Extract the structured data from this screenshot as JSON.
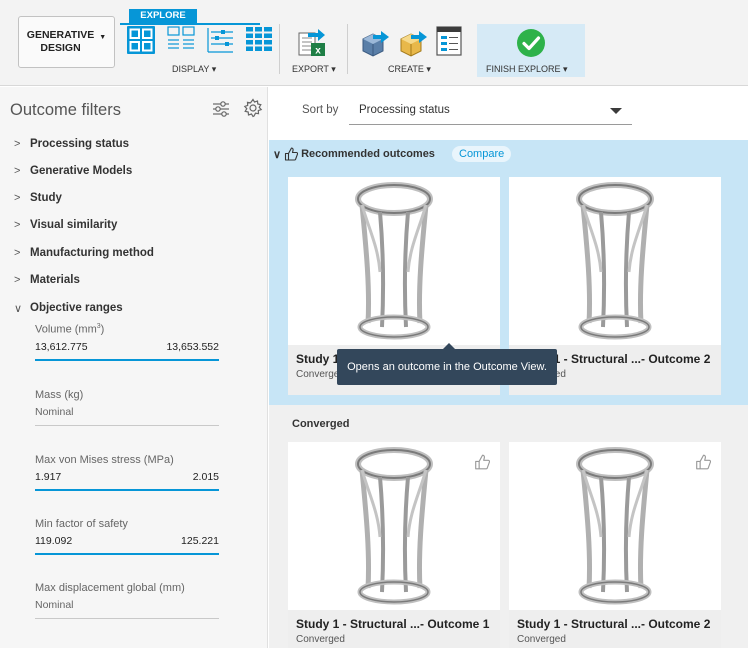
{
  "toolbar": {
    "generative_design": "GENERATIVE\nDESIGN",
    "explore_tab": "EXPLORE",
    "display": "DISPLAY",
    "export": "EXPORT",
    "create": "CREATE",
    "finish_explore": "FINISH EXPLORE",
    "dropdown_caret": "▾"
  },
  "left_panel": {
    "title": "Outcome filters",
    "filters": [
      "Processing status",
      "Generative Models",
      "Study",
      "Visual similarity",
      "Manufacturing method",
      "Materials",
      "Objective ranges"
    ],
    "ranges": {
      "volume": {
        "label": "Volume (mm",
        "unit_sup": "3",
        "label_end": ")",
        "min": "13,612.775",
        "max": "13,653.552"
      },
      "mass": {
        "label": "Mass (kg)",
        "value": "Nominal"
      },
      "stress": {
        "label": "Max von Mises stress (MPa)",
        "min": "1.917",
        "max": "2.015"
      },
      "safety": {
        "label": "Min factor of safety",
        "min": "119.092",
        "max": "125.221"
      },
      "displacement": {
        "label": "Max displacement global (mm)",
        "value": "Nominal"
      }
    }
  },
  "content": {
    "sort_by_label": "Sort by",
    "sort_value": "Processing status",
    "recommended": {
      "heading": "Recommended outcomes",
      "compare": "Compare",
      "cards": [
        {
          "title": "Study 1 - Structural ...- Outcome 1",
          "status": "Converged"
        },
        {
          "title": "Study 1 - Structural ...- Outcome 2",
          "status": "Converged"
        }
      ]
    },
    "tooltip": "Opens an outcome in the Outcome View.",
    "converged": {
      "heading": "Converged",
      "cards": [
        {
          "title": "Study 1 - Structural ...- Outcome 1",
          "status": "Converged"
        },
        {
          "title": "Study 1 - Structural ...- Outcome 2",
          "status": "Converged"
        }
      ]
    }
  },
  "colors": {
    "accent": "#0696d7",
    "recommended_bg": "#c7e5f6",
    "finish_check": "#2eb24a",
    "tooltip_bg": "#33475b"
  },
  "icons": [
    "generative-design-caret",
    "tile-view-icon",
    "list-thumb-view-icon",
    "table-view-icon",
    "scatter-view-icon",
    "export-excel-icon",
    "create-design-icon",
    "create-part-icon",
    "create-drawing-icon",
    "finish-check-icon",
    "filter-settings-icon",
    "gear-icon",
    "chevron-right-icon",
    "chevron-down-icon",
    "recommended-thumb-icon",
    "thumb-up-icon",
    "sort-dropdown-icon"
  ]
}
